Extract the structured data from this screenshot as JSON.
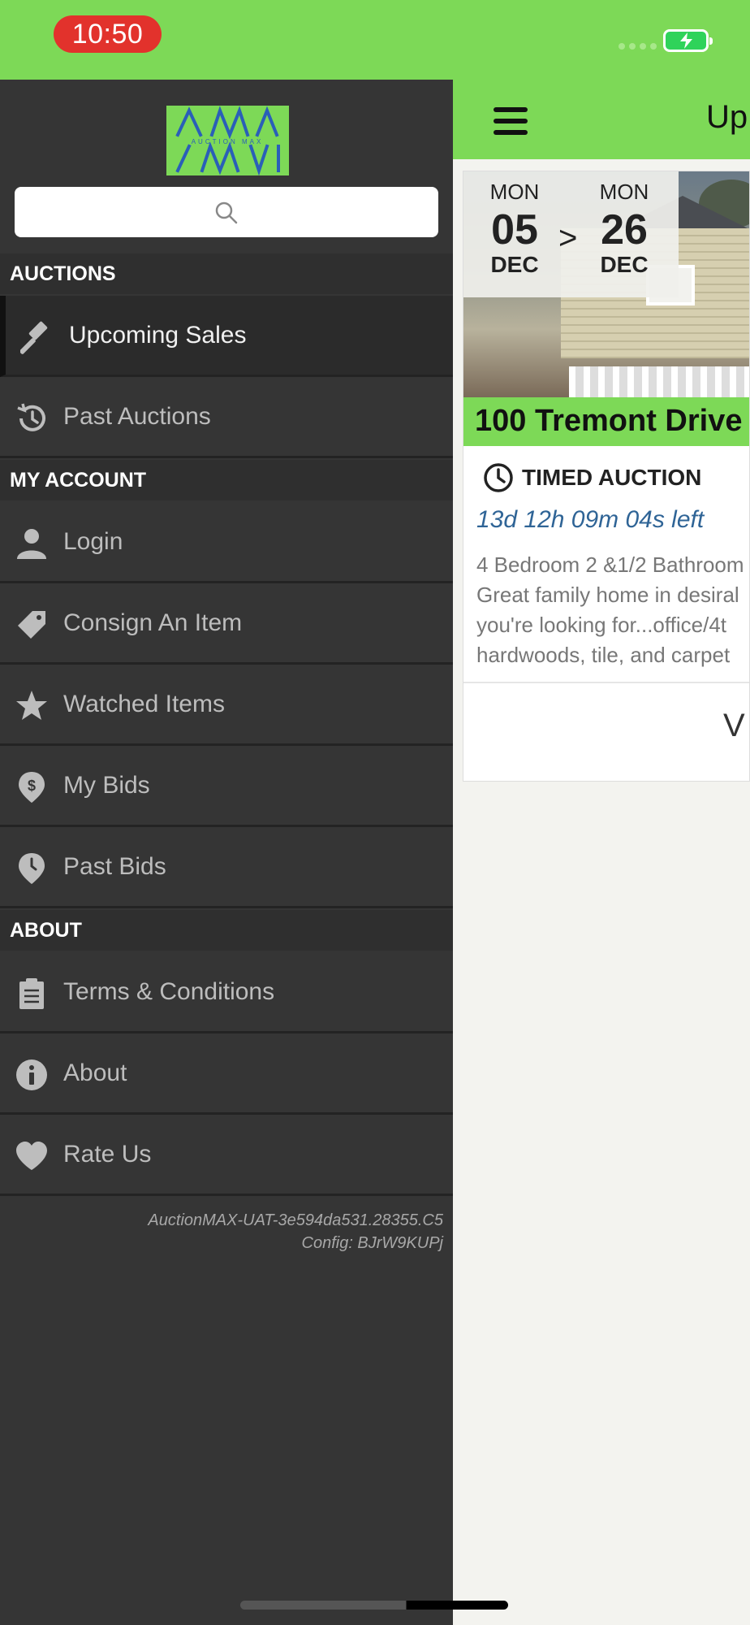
{
  "status_bar": {
    "time": "10:50"
  },
  "app": {
    "logo_text": "AUCTION MAX",
    "search": {
      "placeholder": ""
    }
  },
  "drawer": {
    "sections": [
      {
        "title": "AUCTIONS",
        "items": [
          {
            "label": "Upcoming Sales",
            "icon": "gavel-icon",
            "active": true
          },
          {
            "label": "Past Auctions",
            "icon": "history-icon"
          }
        ]
      },
      {
        "title": "MY ACCOUNT",
        "items": [
          {
            "label": "Login",
            "icon": "user-icon"
          },
          {
            "label": "Consign An Item",
            "icon": "tag-icon"
          },
          {
            "label": "Watched Items",
            "icon": "star-icon"
          },
          {
            "label": "My Bids",
            "icon": "dollar-pin-icon"
          },
          {
            "label": "Past Bids",
            "icon": "clock-pin-icon"
          }
        ]
      },
      {
        "title": "ABOUT",
        "items": [
          {
            "label": "Terms & Conditions",
            "icon": "clipboard-icon"
          },
          {
            "label": "About",
            "icon": "info-icon"
          },
          {
            "label": "Rate Us",
            "icon": "heart-icon"
          }
        ]
      }
    ],
    "build_info": "AuctionMAX-UAT-3e594da531.28355.C5",
    "config_info": "Config: BJrW9KUPj"
  },
  "main": {
    "nav_title": "Up",
    "card": {
      "start": {
        "dow": "MON",
        "day": "05",
        "month": "DEC"
      },
      "arrow": ">",
      "end": {
        "dow": "MON",
        "day": "26",
        "month": "DEC"
      },
      "title": "100 Tremont Drive",
      "auction_type": "TIMED AUCTION",
      "time_left": "13d 12h 09m 04s left",
      "description_lines": [
        "4 Bedroom 2 &1/2 Bathroom",
        "Great family home in desiral",
        "you're looking for...office/4t",
        "hardwoods, tile, and carpet"
      ],
      "button_label": "V"
    }
  },
  "colors": {
    "brand_green": "#7dd957",
    "drawer_bg": "#353535",
    "time_pill": "#e2322c",
    "time_left_blue": "#2f6496"
  }
}
